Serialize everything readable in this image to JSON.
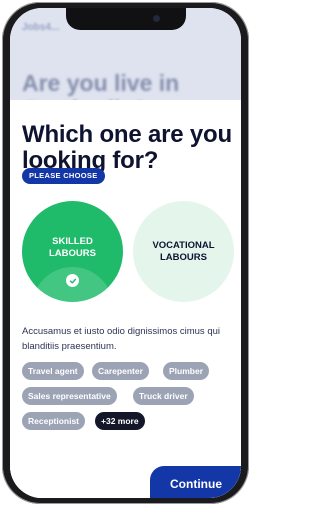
{
  "background": {
    "brand": "Jobs4...",
    "title": "Are you live in Cambodia?"
  },
  "modal": {
    "title": "Which one are you looking for?",
    "badge": "PLEASE CHOOSE",
    "options": [
      {
        "label": "SKILLED LABOURS",
        "selected": true
      },
      {
        "label": "VOCATIONAL LABOURS",
        "selected": false
      }
    ],
    "description": "Accusamus et iusto odio dignissimos cimus qui blanditiis praesentium.",
    "tags": [
      "Travel agent",
      "Carepenter",
      "Plumber",
      "Sales representative",
      "Truck driver",
      "Receptionist"
    ],
    "more_tag": "+32 more",
    "continue_label": "Continue"
  },
  "colors": {
    "primary": "#1437a8",
    "selected": "#1fbb6a",
    "unselected": "#e4f6ec",
    "tag": "#9ca3b5",
    "tag_more": "#14172a",
    "text": "#0e1330"
  }
}
